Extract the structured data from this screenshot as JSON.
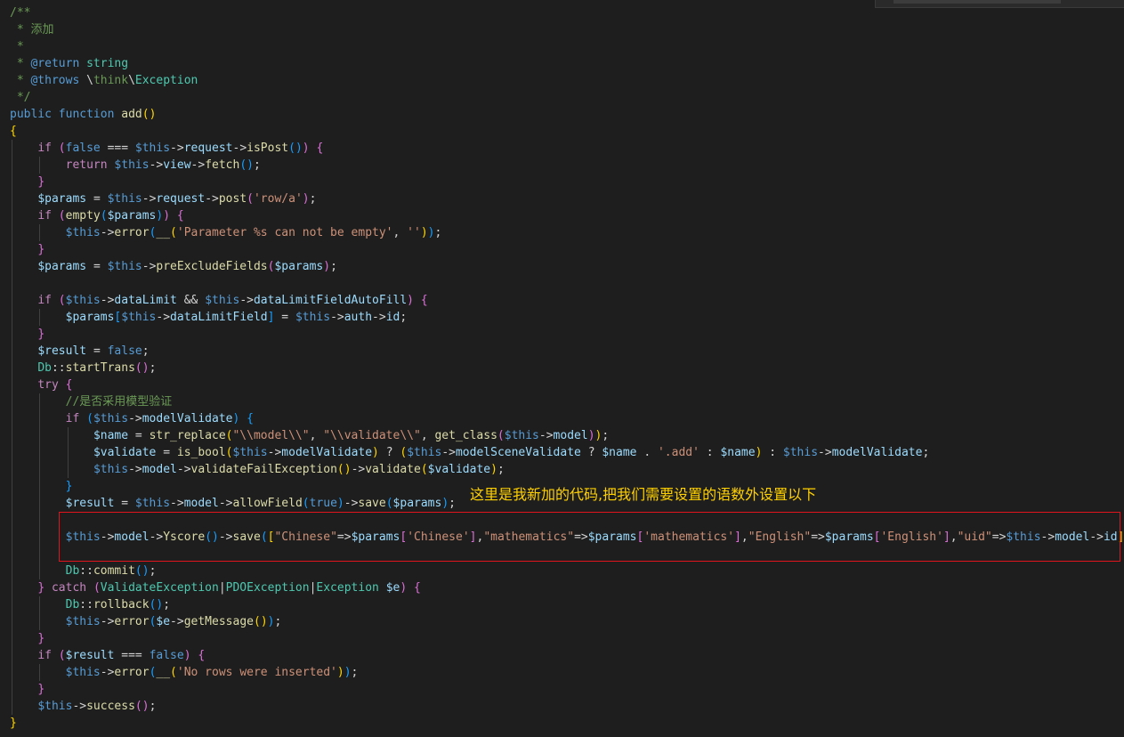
{
  "annotation": {
    "text": "这里是我新加的代码,把我们需要设置的语数外设置以下"
  },
  "colors": {
    "background": "#1e1e1e",
    "annotation": "#ffd000",
    "highlight_box": "#e0141c"
  },
  "code": [
    "/**",
    " * 添加",
    " *",
    " * @return string",
    " * @throws \\think\\Exception",
    " */",
    "public function add()",
    "{",
    "    if (false === $this->request->isPost()) {",
    "        return $this->view->fetch();",
    "    }",
    "    $params = $this->request->post('row/a');",
    "    if (empty($params)) {",
    "        $this->error(__('Parameter %s can not be empty', ''));",
    "    }",
    "    $params = $this->preExcludeFields($params);",
    "",
    "    if ($this->dataLimit && $this->dataLimitFieldAutoFill) {",
    "        $params[$this->dataLimitField] = $this->auth->id;",
    "    }",
    "    $result = false;",
    "    Db::startTrans();",
    "    try {",
    "        //是否采用模型验证",
    "        if ($this->modelValidate) {",
    "            $name = str_replace(\"\\\\model\\\\\", \"\\\\validate\\\\\", get_class($this->model));",
    "            $validate = is_bool($this->modelValidate) ? ($this->modelSceneValidate ? $name . '.add' : $name) : $this->modelValidate;",
    "            $this->model->validateFailException()->validate($validate);",
    "        }",
    "        $result = $this->model->allowField(true)->save($params);",
    "",
    "        $this->model->Yscore()->save([\"Chinese\"=>$params['Chinese'],\"mathematics\"=>$params['mathematics'],\"English\"=>$params['English'],\"uid\"=>$this->model->id]);",
    "",
    "        Db::commit();",
    "    } catch (ValidateException|PDOException|Exception $e) {",
    "        Db::rollback();",
    "        $this->error($e->getMessage());",
    "    }",
    "    if ($result === false) {",
    "        $this->error(__('No rows were inserted'));",
    "    }",
    "    $this->success();",
    "}"
  ]
}
